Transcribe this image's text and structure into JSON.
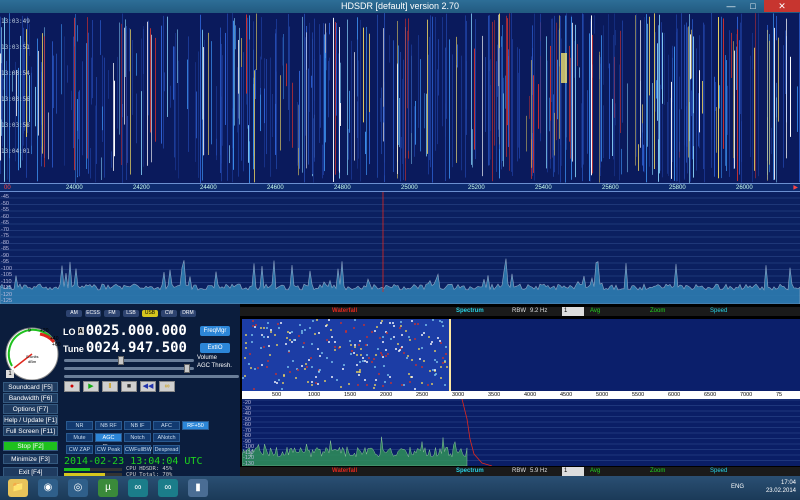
{
  "window": {
    "title": "HDSDR [default]  version 2.70"
  },
  "waterfall": {
    "times": [
      "13:03:49",
      "13:03:51",
      "13:03:54",
      "13:03:56",
      "13:03:58",
      "13:04:01"
    ]
  },
  "freq_axis": {
    "start_label": "00",
    "labels": [
      "24000",
      "24200",
      "24400",
      "24600",
      "24800",
      "25000",
      "25200",
      "25400",
      "25600",
      "25800",
      "26000"
    ],
    "end_label": "▶"
  },
  "spectrum": {
    "db_labels": [
      "-45",
      "-50",
      "-55",
      "-60",
      "-65",
      "-70",
      "-75",
      "-80",
      "-85",
      "-90",
      "-95",
      "-100",
      "-105",
      "-110",
      "-115",
      "-120",
      "-125"
    ]
  },
  "meter": {
    "scale": [
      "+20",
      "+40",
      "9",
      "+60",
      "S-units",
      "dBm"
    ],
    "badge": "1"
  },
  "frequency": {
    "lo_label": "LO",
    "lo_badge": "A",
    "lo_value": "0025.000.000",
    "tune_label": "Tune",
    "tune_value": "0024.947.500"
  },
  "top_modes": [
    "AM",
    "ECSS",
    "FM",
    "LSB",
    "USB",
    "CW",
    "DRM"
  ],
  "buttons": {
    "freqmgr": "FreqMgr",
    "extio": "ExtIO"
  },
  "slider_labels": {
    "volume": "Volume",
    "agc": "AGC Thresh."
  },
  "nav": [
    "Soundcard  [F5]",
    "Bandwidth  [F6]",
    "Options  [F7]",
    "Help / Update  [F1]",
    "Full Screen  [F11]",
    "Stop  [F2]",
    "Minimize  [F3]",
    "Exit  [F4]"
  ],
  "transport": [
    "●",
    "▶",
    "Ⅱ",
    "■",
    "◀◀",
    "∞"
  ],
  "mode_buttons": {
    "row1": [
      "NR",
      "NB RF",
      "NB IF",
      "AFC",
      "RF+50"
    ],
    "row2": [
      "Mute",
      "AGC Slow",
      "Notch",
      "ANotch"
    ],
    "row3": [
      "CW ZAP",
      "CW Peak",
      "CWFullBW",
      "Despread"
    ]
  },
  "datetime": "2014-02-23   13:04:04 UTC",
  "cpu": {
    "hdsdr": "CPU HDSDR:  45%",
    "total": "CPU Total:  70%"
  },
  "waterfall_bar": {
    "label": "Waterfall",
    "spectrum": "Spectrum",
    "rbw_label": "RBW",
    "rbw_value": "9.2 Hz",
    "avg_value": "1",
    "avg": "Avg",
    "zoom": "Zoom",
    "speed": "Speed"
  },
  "sub_axis": {
    "labels": [
      "500",
      "1000",
      "1500",
      "2000",
      "2500",
      "3000",
      "3500",
      "4000",
      "4500",
      "5000",
      "5500",
      "6000",
      "6500",
      "7000",
      "75"
    ]
  },
  "sub_spectrum": {
    "db_labels": [
      "-20",
      "-30",
      "-40",
      "-50",
      "-60",
      "-70",
      "-80",
      "-90",
      "-100",
      "-110",
      "-120",
      "-130"
    ]
  },
  "bottom_bar": {
    "label": "Waterfall",
    "spectrum": "Spectrum",
    "rbw_label": "RBW",
    "rbw_value": "5.9 Hz",
    "avg_value": "1",
    "avg": "Avg",
    "zoom": "Zoom",
    "speed": "Speed"
  },
  "taskbar": {
    "lang": "ENG",
    "time": "17:04",
    "date": "23.02.2014"
  },
  "colors": {
    "accent_green": "#1ec01e",
    "marker_red": "#e0281e",
    "waterfall_blue": "#0a1a5c"
  }
}
